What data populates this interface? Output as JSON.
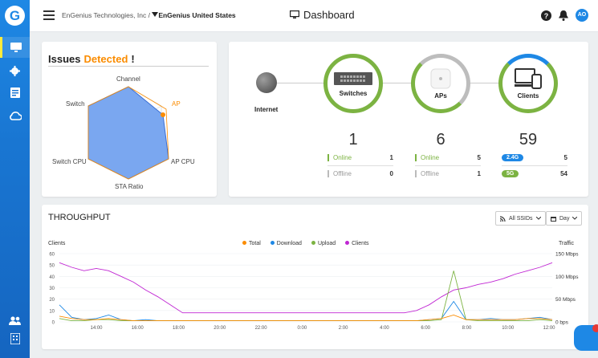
{
  "topbar": {
    "org": "EnGenius Technologies, Inc",
    "separator": " / ",
    "site": "EnGenius United States",
    "page_title": "Dashboard",
    "avatar_initials": "AO"
  },
  "sidebar": {
    "items": [
      {
        "icon": "monitor-icon",
        "active": true
      },
      {
        "icon": "gear-icon"
      },
      {
        "icon": "report-icon"
      },
      {
        "icon": "cloud-icon"
      },
      {
        "icon": "users-icon"
      },
      {
        "icon": "building-icon"
      }
    ]
  },
  "issues": {
    "title": "Issues",
    "detected": "Detected",
    "exclaim": "!",
    "axes": [
      "Channel",
      "AP",
      "AP CPU",
      "STA Ratio",
      "Switch CPU",
      "Switch"
    ]
  },
  "topology": {
    "internet": "Internet",
    "switches": {
      "label": "Switches",
      "count": "1",
      "online_label": "Online",
      "online": "1",
      "offline_label": "Offline",
      "offline": "0"
    },
    "aps": {
      "label": "APs",
      "count": "6",
      "online_label": "Online",
      "online": "5",
      "offline_label": "Offline",
      "offline": "1"
    },
    "clients": {
      "label": "Clients",
      "count": "59",
      "band_24_label": "2.4G",
      "band_24": "5",
      "band_5_label": "5G",
      "band_5": "54"
    }
  },
  "throughput": {
    "title": "THROUGHPUT",
    "ssid_filter": "All SSIDs",
    "range_filter": "Day",
    "left_axis_title": "Clients",
    "right_axis_title": "Traffic",
    "legend": [
      "Total",
      "Download",
      "Upload",
      "Clients"
    ]
  },
  "colors": {
    "accent": "#1e88e5",
    "orange": "#fb8c00",
    "green": "#7cb342",
    "gray": "#9e9e9e",
    "magenta": "#c026d3",
    "radar_fill": "#7aa7f0"
  },
  "chart_data": {
    "type": "line",
    "x": [
      "14:00",
      "16:00",
      "18:00",
      "20:00",
      "22:00",
      "0:00",
      "2:00",
      "4:00",
      "6:00",
      "8:00",
      "10:00",
      "12:00"
    ],
    "y_left_ticks": [
      "60",
      "50",
      "40",
      "30",
      "20",
      "10",
      "0"
    ],
    "y_right_ticks": [
      "150 Mbps",
      "100 Mbps",
      "50 Mbps",
      "0 bps"
    ],
    "ylim_left": [
      0,
      60
    ],
    "series": [
      {
        "name": "Clients",
        "color": "#c026d3",
        "values": [
          52,
          48,
          45,
          47,
          45,
          40,
          35,
          28,
          22,
          15,
          8,
          8,
          8,
          8,
          8,
          8,
          8,
          8,
          8,
          8,
          8,
          8,
          8,
          8,
          8,
          8,
          8,
          8,
          8,
          10,
          15,
          22,
          28,
          30,
          33,
          35,
          38,
          42,
          45,
          48,
          52
        ]
      },
      {
        "name": "Download",
        "color": "#1e88e5",
        "values": [
          15,
          4,
          2,
          3,
          6,
          2,
          1,
          2,
          1,
          1,
          1,
          1,
          1,
          1,
          1,
          1,
          1,
          1,
          1,
          1,
          1,
          1,
          1,
          1,
          1,
          1,
          1,
          1,
          1,
          1,
          2,
          3,
          18,
          2,
          2,
          3,
          2,
          2,
          3,
          4,
          2
        ]
      },
      {
        "name": "Upload",
        "color": "#7cb342",
        "values": [
          3,
          1,
          1,
          2,
          2,
          1,
          1,
          1,
          1,
          1,
          1,
          1,
          1,
          1,
          1,
          1,
          1,
          1,
          1,
          1,
          1,
          1,
          1,
          1,
          1,
          1,
          1,
          1,
          1,
          1,
          1,
          2,
          45,
          2,
          1,
          1,
          1,
          1,
          1,
          2,
          1
        ]
      },
      {
        "name": "Total",
        "color": "#fb8c00",
        "values": [
          5,
          3,
          2,
          2,
          3,
          2,
          1,
          1,
          1,
          1,
          1,
          1,
          1,
          1,
          1,
          1,
          1,
          1,
          1,
          1,
          1,
          1,
          1,
          1,
          1,
          1,
          1,
          1,
          1,
          1,
          2,
          3,
          6,
          2,
          2,
          2,
          2,
          2,
          3,
          3,
          2
        ]
      }
    ],
    "legend_placement": "top-center",
    "grid": true
  }
}
